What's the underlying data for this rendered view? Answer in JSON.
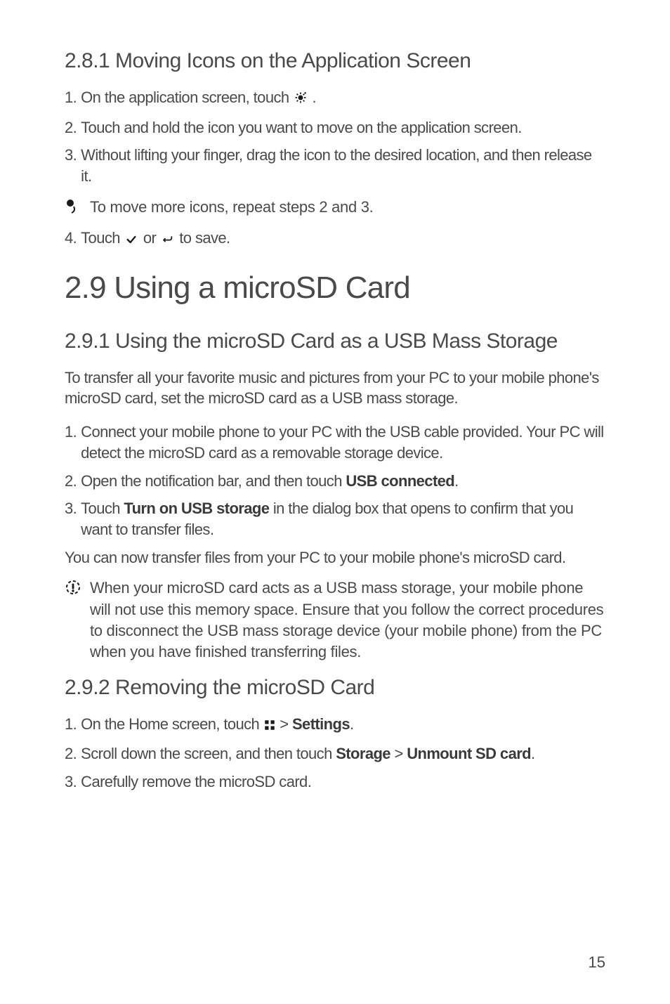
{
  "s281": {
    "heading": "2.8.1  Moving Icons on the Application Screen",
    "step1_a": "1.",
    "step1_b": "On the application screen, touch ",
    "step1_c": " .",
    "step2_a": "2.",
    "step2_b": "Touch and hold the icon you want to move on the application screen.",
    "step3_a": "3.",
    "step3_b": "Without lifting your finger, drag the icon to the desired location, and then release it.",
    "note": "To move more icons, repeat steps 2 and 3.",
    "step4_a": "4.",
    "step4_b": "Touch ",
    "step4_c": " or ",
    "step4_d": " to save."
  },
  "s29": {
    "heading": "2.9  Using a microSD Card"
  },
  "s291": {
    "heading": "2.9.1  Using the microSD Card as a USB Mass Storage",
    "intro": "To transfer all your favorite music and pictures from your PC to your mobile phone's microSD card, set the microSD card as a USB mass storage.",
    "step1_a": "1.",
    "step1_b": "Connect your mobile phone to your PC with the USB cable provided. Your PC will detect the microSD card as a removable storage device.",
    "step2_a": "2.",
    "step2_b": "Open the notification bar, and then touch ",
    "step2_bold": "USB connected",
    "step2_c": ".",
    "step3_a": "3.",
    "step3_b": "Touch ",
    "step3_bold": "Turn on USB storage",
    "step3_c": " in the dialog box that opens to confirm that you want to transfer files.",
    "outro": "You can now transfer files from your PC to your mobile phone's microSD card.",
    "note": "When your microSD card acts as a USB mass storage, your mobile phone will not use this memory space. Ensure that you follow the correct procedures to disconnect the USB mass storage device (your mobile phone) from the PC when you have finished transferring files."
  },
  "s292": {
    "heading": "2.9.2  Removing the microSD Card",
    "step1_a": "1.",
    "step1_b": "On the Home screen, touch ",
    "step1_c": "  > ",
    "step1_bold": "Settings",
    "step1_d": ".",
    "step2_a": "2.",
    "step2_b": "Scroll down the screen, and then touch ",
    "step2_bold1": "Storage",
    "step2_c": " > ",
    "step2_bold2": "Unmount SD card",
    "step2_d": ".",
    "step3_a": "3.",
    "step3_b": "Carefully remove the microSD card."
  },
  "page_number": "15"
}
